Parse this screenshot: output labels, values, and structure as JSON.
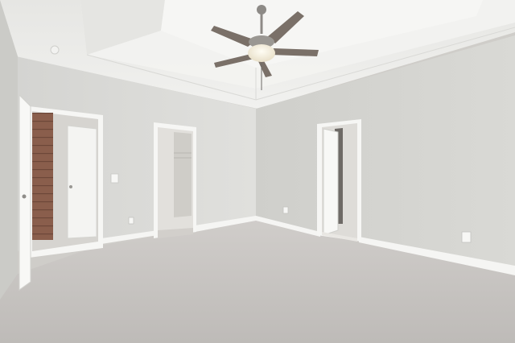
{
  "image": {
    "kind": "photograph",
    "subject": "empty-bedroom"
  },
  "palette": {
    "ceiling": "#ebebe9",
    "tray_ceiling": "#f4f4f2",
    "wall_left": "#dcdcd9",
    "wall_right": "#d3d3cf",
    "carpet": "#c9c6c3",
    "trim": "#f7f7f5",
    "fan_metal": "#8d8a86",
    "fan_blade": "#7a7068",
    "brick": "#8a5e4c"
  }
}
